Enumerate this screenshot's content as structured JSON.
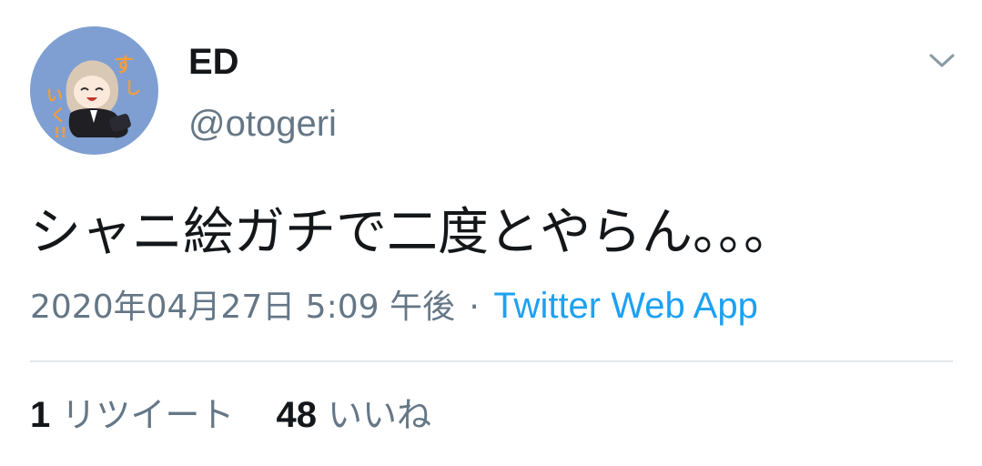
{
  "author": {
    "display_name": "ED",
    "handle": "@otogeri"
  },
  "tweet": {
    "text": "シャニ絵ガチで二度とやらん。。。",
    "timestamp": "2020年04月27日 5:09 午後",
    "separator": "·",
    "source": "Twitter Web App"
  },
  "stats": {
    "retweets_count": "1",
    "retweets_label": "リツイート",
    "likes_count": "48",
    "likes_label": "いいね"
  },
  "icons": {
    "menu": "chevron-down-icon",
    "avatar": "profile-avatar"
  },
  "colors": {
    "link": "#1da1f2",
    "secondary_text": "#657786",
    "primary_text": "#14171a",
    "divider": "#e1e8ed",
    "avatar_bg": "#7f9fd2"
  }
}
